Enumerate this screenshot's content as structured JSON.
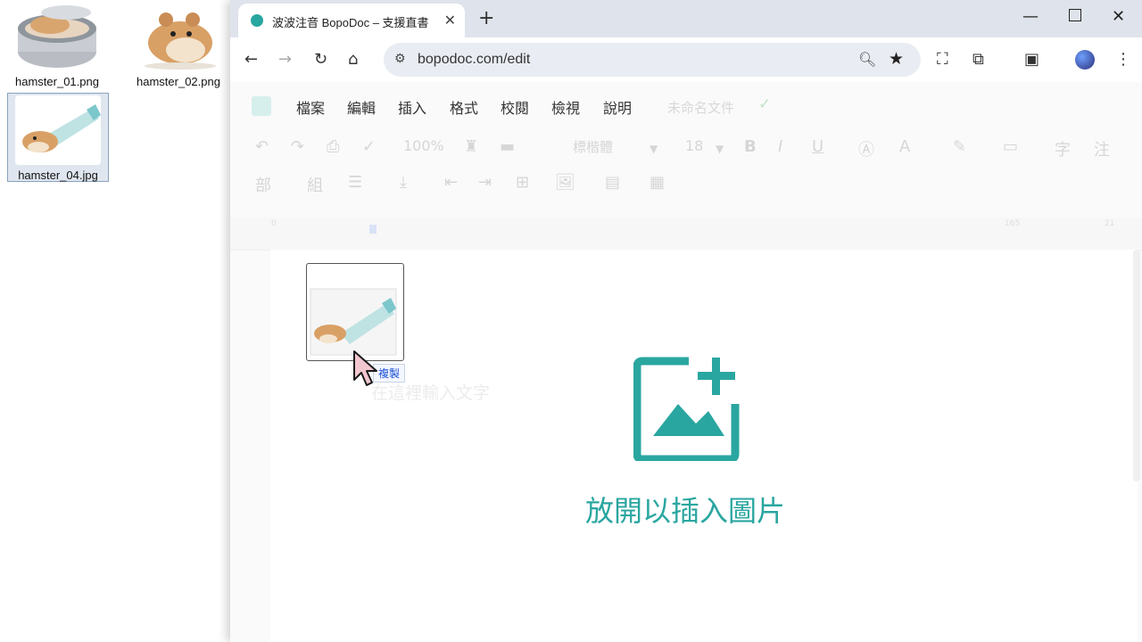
{
  "desktop": {
    "icons": [
      {
        "label": "hamster_01.png"
      },
      {
        "label": "hamster_02.png"
      },
      {
        "label": "hamster_04.jpg"
      }
    ]
  },
  "browser": {
    "tab_title": "波波注音 BopoDoc – 支援直書",
    "url": "bopodoc.com/edit"
  },
  "app": {
    "menu": [
      "檔案",
      "編輯",
      "插入",
      "格式",
      "校閱",
      "檢視",
      "說明"
    ],
    "doc_title": "未命名文件",
    "toolbar": {
      "zoom": "100%",
      "font": "標楷體",
      "font_size": "18"
    },
    "ruler_marks": [
      "0",
      "165",
      "21"
    ],
    "placeholder_text": "在這裡輸入文字"
  },
  "overlay": {
    "drop_label": "放開以插入圖片",
    "copy_badge": "複製",
    "accent": "#2aa6a0"
  }
}
